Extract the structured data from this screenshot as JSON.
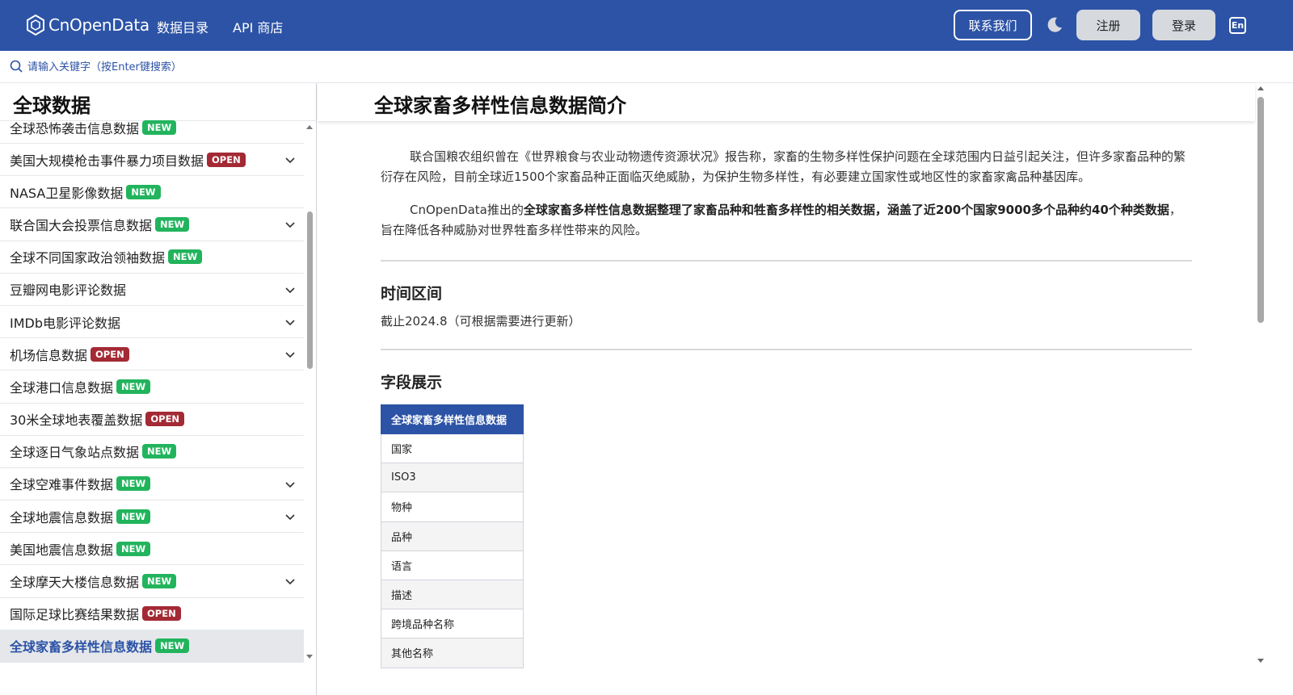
{
  "header": {
    "logo_text": "CnOpenData",
    "nav": [
      "数据目录",
      "API 商店"
    ],
    "contact_label": "联系我们",
    "register_label": "注册",
    "login_label": "登录",
    "lang_label": "En"
  },
  "search": {
    "placeholder": "请输入关键字（按Enter键搜索）"
  },
  "sidebar": {
    "title": "全球数据",
    "first_item": {
      "label": "全球恐怖袭击信息数据",
      "badge": "NEW"
    },
    "items": [
      {
        "label": "美国大规模枪击事件暴力项目数据",
        "badge": "OPEN",
        "expandable": true
      },
      {
        "label": "NASA卫星影像数据",
        "badge": "NEW",
        "expandable": false
      },
      {
        "label": "联合国大会投票信息数据",
        "badge": "NEW",
        "expandable": true
      },
      {
        "label": "全球不同国家政治领袖数据",
        "badge": "NEW",
        "expandable": false
      },
      {
        "label": "豆瓣网电影评论数据",
        "badge": "",
        "expandable": true
      },
      {
        "label": "IMDb电影评论数据",
        "badge": "",
        "expandable": true
      },
      {
        "label": "机场信息数据",
        "badge": "OPEN",
        "expandable": true
      },
      {
        "label": "全球港口信息数据",
        "badge": "NEW",
        "expandable": false
      },
      {
        "label": "30米全球地表覆盖数据",
        "badge": "OPEN",
        "expandable": false
      },
      {
        "label": "全球逐日气象站点数据",
        "badge": "NEW",
        "expandable": false
      },
      {
        "label": "全球空难事件数据",
        "badge": "NEW",
        "expandable": true
      },
      {
        "label": "全球地震信息数据",
        "badge": "NEW",
        "expandable": true
      },
      {
        "label": "美国地震信息数据",
        "badge": "NEW",
        "expandable": false
      },
      {
        "label": "全球摩天大楼信息数据",
        "badge": "NEW",
        "expandable": true
      },
      {
        "label": "国际足球比赛结果数据",
        "badge": "OPEN",
        "expandable": false
      },
      {
        "label": "全球家畜多样性信息数据",
        "badge": "NEW",
        "expandable": false,
        "active": true
      }
    ]
  },
  "main": {
    "title": "全球家畜多样性信息数据简介",
    "intro_1": "联合国粮农组织曾在《世界粮食与农业动物遗传资源状况》报告称，家畜的生物多样性保护问题在全球范围内日益引起关注，但许多家畜品种的繁衍存在风险，目前全球近1500个家畜品种正面临灭绝威胁，为保护生物多样性，有必要建立国家性或地区性的家畜家禽品种基因库。",
    "intro_2_prefix": "CnOpenData推出的",
    "intro_2_bold": "全球家畜多样性信息数据整理了家畜品种和牲畜多样性的相关数据，涵盖了近200个国家9000多个品种约40个种类数据",
    "intro_2_suffix": "，旨在降低各种威胁对世界牲畜多样性带来的风险。",
    "time_title": "时间区间",
    "time_text": "截止2024.8（可根据需要进行更新）",
    "fields_title": "字段展示",
    "table_header": "全球家畜多样性信息数据",
    "fields": [
      "国家",
      "ISO3",
      "物种",
      "品种",
      "语言",
      "描述",
      "跨境品种名称",
      "其他名称"
    ]
  },
  "colors": {
    "brand": "#2c53a6",
    "badge_new": "#22b45d",
    "badge_open": "#a32a35"
  }
}
